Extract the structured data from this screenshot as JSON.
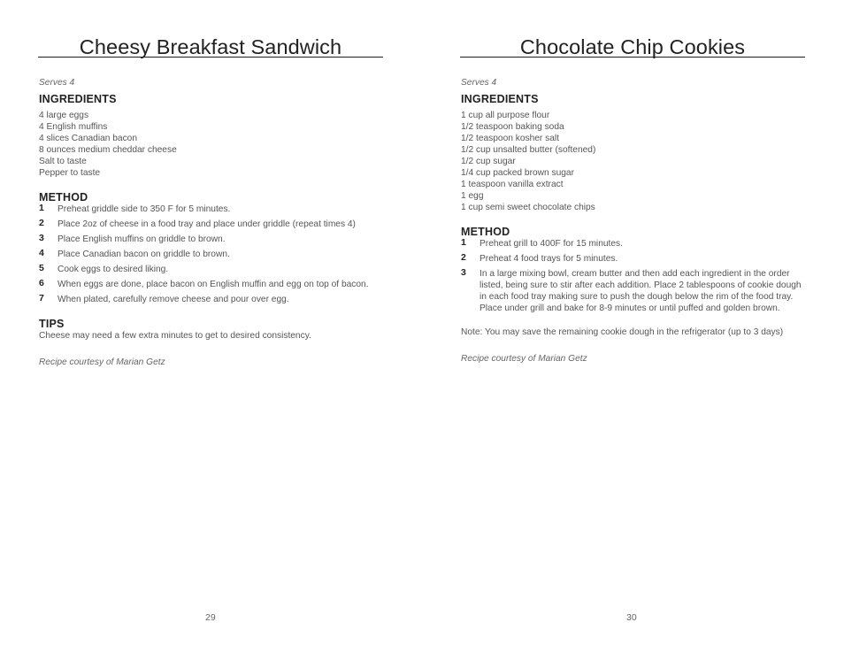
{
  "left_page": {
    "title": "Cheesy Breakfast Sandwich",
    "serves": "Serves 4",
    "ingredients_heading": "INGREDIENTS",
    "ingredients": [
      "4 large eggs",
      "4 English muffins",
      "4 slices Canadian bacon",
      "8 ounces medium cheddar cheese",
      "Salt to taste",
      "Pepper to taste"
    ],
    "method_heading": "METHOD",
    "steps": [
      {
        "num": "1",
        "text": "Preheat griddle side to 350 F for 5 minutes."
      },
      {
        "num": "2",
        "text": "Place 2oz of cheese in a food tray and place under griddle (repeat times 4)"
      },
      {
        "num": "3",
        "text": "Place English muffins on griddle to brown."
      },
      {
        "num": "4",
        "text": "Place Canadian bacon on griddle to brown."
      },
      {
        "num": "5",
        "text": "Cook eggs to desired liking."
      },
      {
        "num": "6",
        "text": "When eggs are done, place bacon on English muffin and egg on top of bacon."
      },
      {
        "num": "7",
        "text": "When plated, carefully remove cheese and pour over egg."
      }
    ],
    "tips_heading": "TIPS",
    "tips_text": "Cheese may need a few extra minutes to get to desired consistency.",
    "credit": "Recipe courtesy of Marian Getz",
    "page_number": "29"
  },
  "right_page": {
    "title": "Chocolate Chip Cookies",
    "serves": "Serves 4",
    "ingredients_heading": "INGREDIENTS",
    "ingredients": [
      "1 cup all purpose flour",
      "1/2 teaspoon baking soda",
      "1/2 teaspoon kosher salt",
      "1/2 cup unsalted butter (softened)",
      "1/2 cup sugar",
      "1/4 cup packed brown sugar",
      "1 teaspoon vanilla extract",
      "1 egg",
      "1 cup semi sweet chocolate chips"
    ],
    "method_heading": "METHOD",
    "steps": [
      {
        "num": "1",
        "text": "Preheat grill to 400F for 15 minutes."
      },
      {
        "num": "2",
        "text": "Preheat 4 food trays for 5 minutes."
      },
      {
        "num": "3",
        "text": "In a large mixing bowl, cream butter and then add each ingredient in the order listed, being sure to stir after each addition. Place 2 tablespoons of cookie dough in each food tray making sure to push the dough below the rim of the food tray. Place under grill and bake for 8-9 minutes or until puffed and golden brown."
      }
    ],
    "note": "Note: You may save the remaining cookie dough in the refrigerator (up to 3 days)",
    "credit": "Recipe courtesy of Marian Getz",
    "page_number": "30"
  }
}
